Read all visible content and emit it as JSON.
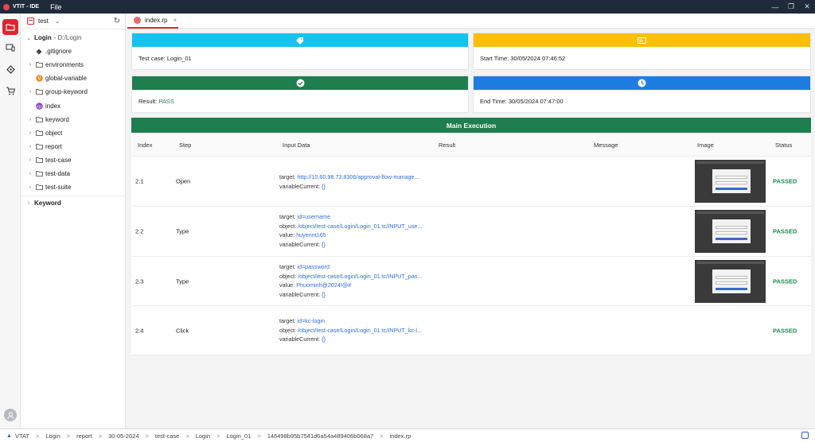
{
  "app": {
    "title": "VTIT - IDE",
    "menu_file": "File"
  },
  "sidebar": {
    "project": "test",
    "tree": [
      {
        "label": "Login",
        "suffix": "- D:/Login",
        "type": "root"
      },
      {
        "label": ".gitignore",
        "type": "git"
      },
      {
        "label": "environments",
        "type": "folder"
      },
      {
        "label": "global-variable",
        "type": "var"
      },
      {
        "label": "group-keyword",
        "type": "folder"
      },
      {
        "label": "index",
        "type": "index"
      },
      {
        "label": "keyword",
        "type": "folder"
      },
      {
        "label": "object",
        "type": "folder"
      },
      {
        "label": "report",
        "type": "folder"
      },
      {
        "label": "test-case",
        "type": "folder"
      },
      {
        "label": "test-data",
        "type": "folder"
      },
      {
        "label": "test-suite",
        "type": "folder"
      }
    ],
    "keyword_section": "Keyword"
  },
  "tab": {
    "label": "index.rp",
    "close": "×"
  },
  "summary": {
    "test_case_label": "Test case:",
    "test_case_value": "Login_01",
    "start_label": "Start Time:",
    "start_value": "30/05/2024 07:46:52",
    "result_label": "Result:",
    "result_value": "PASS",
    "end_label": "End Time:",
    "end_value": "30/05/2024 07:47:00",
    "colors": {
      "cyan": "#13c3f0",
      "yellow": "#fbbf07",
      "green": "#1e7e4e",
      "blue": "#1f7de2"
    }
  },
  "main_execution": {
    "title": "Main Execution",
    "headers": [
      "Index",
      "Step",
      "Input Data",
      "Result",
      "Message",
      "Image",
      "Status"
    ],
    "rows": [
      {
        "index": "2.1",
        "step": "Open",
        "inputs": [
          {
            "label": "target:",
            "value": "http://10.60.98.73:8306/approval-flow-manage..."
          },
          {
            "label": "variableCurrent:",
            "value": "{}"
          }
        ],
        "status": "PASSED"
      },
      {
        "index": "2.2",
        "step": "Type",
        "inputs": [
          {
            "label": "target:",
            "value": "id=username"
          },
          {
            "label": "object:",
            "value": "/object/test-case/Login/Login_01.tc/INPUT_use..."
          },
          {
            "label": "value:",
            "value": "huyennt165"
          },
          {
            "label": "variableCurrent:",
            "value": "{}"
          }
        ],
        "status": "PASSED"
      },
      {
        "index": "2.3",
        "step": "Type",
        "inputs": [
          {
            "label": "target:",
            "value": "id=password"
          },
          {
            "label": "object:",
            "value": "/object/test-case/Login/Login_01.tc/INPUT_pas..."
          },
          {
            "label": "value:",
            "value": "Phuominh@2024!@#"
          },
          {
            "label": "variableCurrent:",
            "value": "{}"
          }
        ],
        "status": "PASSED"
      },
      {
        "index": "2.4",
        "step": "Click",
        "inputs": [
          {
            "label": "target:",
            "value": "id=kc-login"
          },
          {
            "label": "object:",
            "value": "/object/test-case/Login/Login_01.tc/INPUT_kc-l..."
          },
          {
            "label": "variableCurrent:",
            "value": "{}"
          }
        ],
        "status": "PASSED"
      }
    ]
  },
  "statusbar": {
    "crumbs": [
      "VTAT",
      "Login",
      "report",
      "30-05-2024",
      "test-case",
      "Login",
      "Login_01",
      "146498b95b7541d6a54a489406b068a7",
      "index.rp"
    ]
  }
}
